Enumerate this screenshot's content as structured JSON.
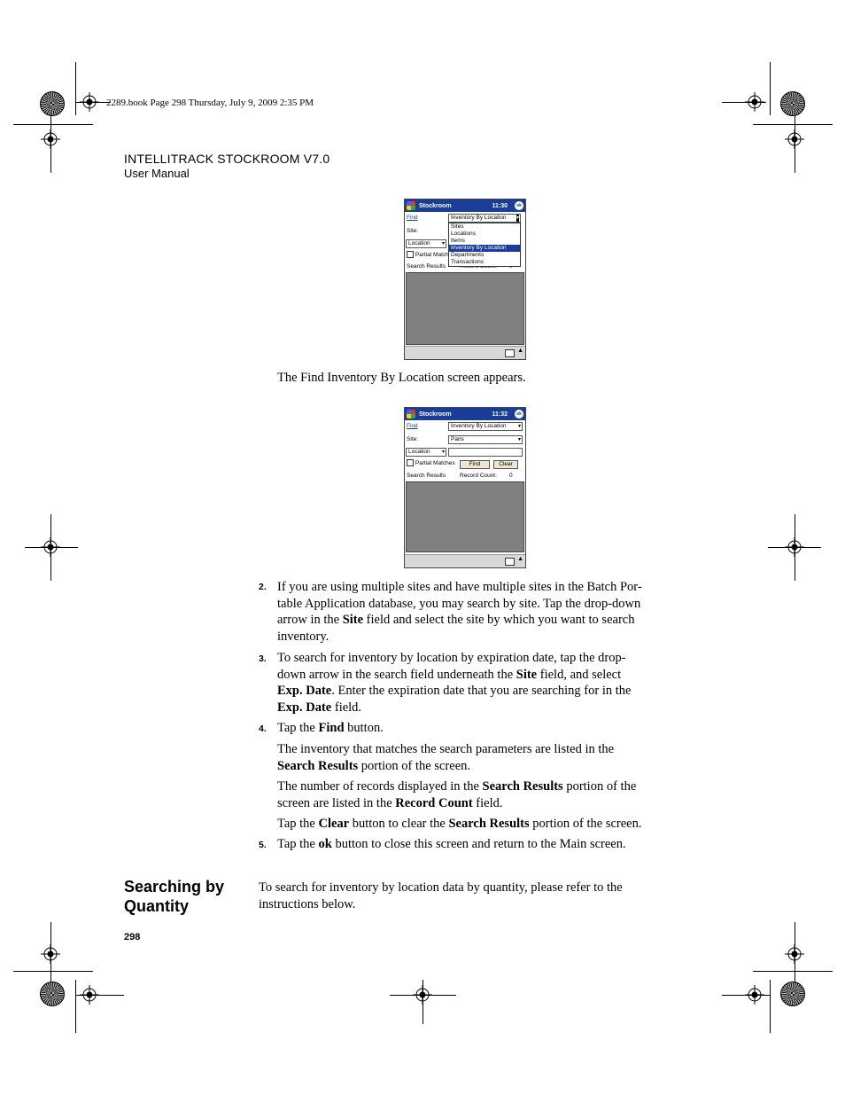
{
  "header": {
    "book_line": "2289.book  Page 298  Thursday, July 9, 2009  2:35 PM",
    "title": "INTELLITRACK STOCKROOM V7.0",
    "subtitle": "User Manual"
  },
  "screen1": {
    "app_title": "Stockroom",
    "time": "11:30",
    "ok": "ok",
    "find_label": "Find",
    "find_value": "Inventory By Location",
    "site_label": "Site:",
    "location_label": "Location",
    "partial_label": "Partial Match",
    "search_results_label": "Search Results",
    "record_count_label": "Record Count:",
    "record_count_value": "0",
    "dropdown_items": [
      "Sites",
      "Locations",
      "Items",
      "Inventory By Location",
      "Departments",
      "Transactions"
    ],
    "dropdown_selected": "Inventory By Location"
  },
  "caption1": "The Find Inventory By Location screen appears.",
  "screen2": {
    "app_title": "Stockroom",
    "time": "11:32",
    "ok": "ok",
    "find_label": "Find",
    "find_value": "Inventory By Location",
    "site_label": "Site:",
    "site_value": "Paris",
    "location_label": "Location",
    "partial_label": "Partial Matches",
    "find_button": "Find",
    "clear_button": "Clear",
    "search_results_label": "Search Results",
    "record_count_label": "Record Count:",
    "record_count_value": "0"
  },
  "steps": [
    {
      "num": "2.",
      "text_html": "If you are using multiple sites and have multiple sites in the Batch Por-<br>table Application database, you may search by site. Tap the drop-down<br>arrow in the <b>Site</b> field and select the site by which you want to search<br>inventory."
    },
    {
      "num": "3.",
      "text_html": "To search for inventory by location by expiration date, tap the drop-<br>down arrow in the search field underneath the <b>Site</b> field, and select<br><b>Exp. Date</b>. Enter the expiration date that you are searching for in the<br><b>Exp. Date</b> field."
    },
    {
      "num": "4.",
      "text_html": "Tap the <b>Find</b> button."
    },
    {
      "num": "",
      "text_html": "The inventory that matches the search parameters are listed in the<br><b>Search Results</b> portion of the screen."
    },
    {
      "num": "",
      "text_html": "The number of records displayed in the <b>Search Results</b> portion of the<br>screen are listed in the <b>Record Count</b> field."
    },
    {
      "num": "",
      "text_html": "Tap the <b>Clear</b> button to clear the <b>Search Results</b> portion of the screen."
    },
    {
      "num": "5.",
      "text_html": "Tap the <b>ok</b> button to close this screen and return to the Main screen."
    }
  ],
  "section": {
    "heading": "Searching by Quantity",
    "text": "To search for inventory by location data by quantity, please refer to the instructions below."
  },
  "page_number": "298"
}
